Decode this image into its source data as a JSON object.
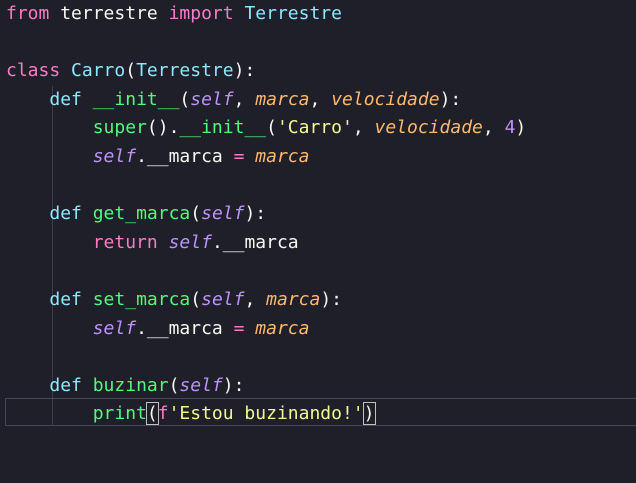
{
  "editor": {
    "lines": [
      {
        "tokens": [
          {
            "t": "from",
            "c": "kw"
          },
          {
            "t": " terrestre ",
            "c": "plain"
          },
          {
            "t": "import",
            "c": "kw"
          },
          {
            "t": " ",
            "c": "plain"
          },
          {
            "t": "Terrestre",
            "c": "cls"
          }
        ]
      },
      {
        "tokens": []
      },
      {
        "tokens": [
          {
            "t": "class",
            "c": "kw"
          },
          {
            "t": " ",
            "c": "plain"
          },
          {
            "t": "Carro",
            "c": "cls"
          },
          {
            "t": "(",
            "c": "plain"
          },
          {
            "t": "Terrestre",
            "c": "cls"
          },
          {
            "t": "):",
            "c": "plain"
          }
        ]
      },
      {
        "tokens": [
          {
            "t": "    ",
            "c": "plain"
          },
          {
            "t": "def",
            "c": "def"
          },
          {
            "t": " ",
            "c": "plain"
          },
          {
            "t": "__init__",
            "c": "fn"
          },
          {
            "t": "(",
            "c": "plain"
          },
          {
            "t": "self",
            "c": "self"
          },
          {
            "t": ", ",
            "c": "plain"
          },
          {
            "t": "marca",
            "c": "param"
          },
          {
            "t": ", ",
            "c": "plain"
          },
          {
            "t": "velocidade",
            "c": "param"
          },
          {
            "t": "):",
            "c": "plain"
          }
        ]
      },
      {
        "tokens": [
          {
            "t": "        ",
            "c": "plain"
          },
          {
            "t": "super",
            "c": "fn"
          },
          {
            "t": "().",
            "c": "plain"
          },
          {
            "t": "__init__",
            "c": "fn"
          },
          {
            "t": "(",
            "c": "plain"
          },
          {
            "t": "'Carro'",
            "c": "str"
          },
          {
            "t": ", ",
            "c": "plain"
          },
          {
            "t": "velocidade",
            "c": "param"
          },
          {
            "t": ", ",
            "c": "plain"
          },
          {
            "t": "4",
            "c": "num"
          },
          {
            "t": ")",
            "c": "plain"
          }
        ]
      },
      {
        "tokens": [
          {
            "t": "        ",
            "c": "plain"
          },
          {
            "t": "self",
            "c": "self"
          },
          {
            "t": ".__marca ",
            "c": "plain"
          },
          {
            "t": "=",
            "c": "kw"
          },
          {
            "t": " ",
            "c": "plain"
          },
          {
            "t": "marca",
            "c": "param"
          }
        ]
      },
      {
        "tokens": []
      },
      {
        "tokens": [
          {
            "t": "    ",
            "c": "plain"
          },
          {
            "t": "def",
            "c": "def"
          },
          {
            "t": " ",
            "c": "plain"
          },
          {
            "t": "get_marca",
            "c": "fn"
          },
          {
            "t": "(",
            "c": "plain"
          },
          {
            "t": "self",
            "c": "self"
          },
          {
            "t": "):",
            "c": "plain"
          }
        ]
      },
      {
        "tokens": [
          {
            "t": "        ",
            "c": "plain"
          },
          {
            "t": "return",
            "c": "kw"
          },
          {
            "t": " ",
            "c": "plain"
          },
          {
            "t": "self",
            "c": "self"
          },
          {
            "t": ".__marca",
            "c": "plain"
          }
        ]
      },
      {
        "tokens": []
      },
      {
        "tokens": [
          {
            "t": "    ",
            "c": "plain"
          },
          {
            "t": "def",
            "c": "def"
          },
          {
            "t": " ",
            "c": "plain"
          },
          {
            "t": "set_marca",
            "c": "fn"
          },
          {
            "t": "(",
            "c": "plain"
          },
          {
            "t": "self",
            "c": "self"
          },
          {
            "t": ", ",
            "c": "plain"
          },
          {
            "t": "marca",
            "c": "param"
          },
          {
            "t": "):",
            "c": "plain"
          }
        ]
      },
      {
        "tokens": [
          {
            "t": "        ",
            "c": "plain"
          },
          {
            "t": "self",
            "c": "self"
          },
          {
            "t": ".__marca ",
            "c": "plain"
          },
          {
            "t": "=",
            "c": "kw"
          },
          {
            "t": " ",
            "c": "plain"
          },
          {
            "t": "marca",
            "c": "param"
          }
        ]
      },
      {
        "tokens": []
      },
      {
        "tokens": [
          {
            "t": "    ",
            "c": "plain"
          },
          {
            "t": "def",
            "c": "def"
          },
          {
            "t": " ",
            "c": "plain"
          },
          {
            "t": "buzinar",
            "c": "fn"
          },
          {
            "t": "(",
            "c": "plain"
          },
          {
            "t": "self",
            "c": "self"
          },
          {
            "t": "):",
            "c": "plain"
          }
        ]
      },
      {
        "tokens": [
          {
            "t": "        ",
            "c": "plain"
          },
          {
            "t": "print",
            "c": "fn"
          },
          {
            "t": "(",
            "c": "plain",
            "match": true
          },
          {
            "t": "f",
            "c": "kw"
          },
          {
            "t": "'Estou buzinando!'",
            "c": "str"
          },
          {
            "t": ")",
            "c": "plain",
            "match": true
          }
        ]
      }
    ],
    "current_line_index": 14
  },
  "colors": {
    "background": "#1e1f29",
    "keyword": "#ff79c6",
    "class": "#8be9fd",
    "function": "#50fa7b",
    "parameter": "#ffb86c",
    "self": "#bd93f9",
    "string": "#f1fa8c",
    "plain": "#f8f8f2"
  }
}
